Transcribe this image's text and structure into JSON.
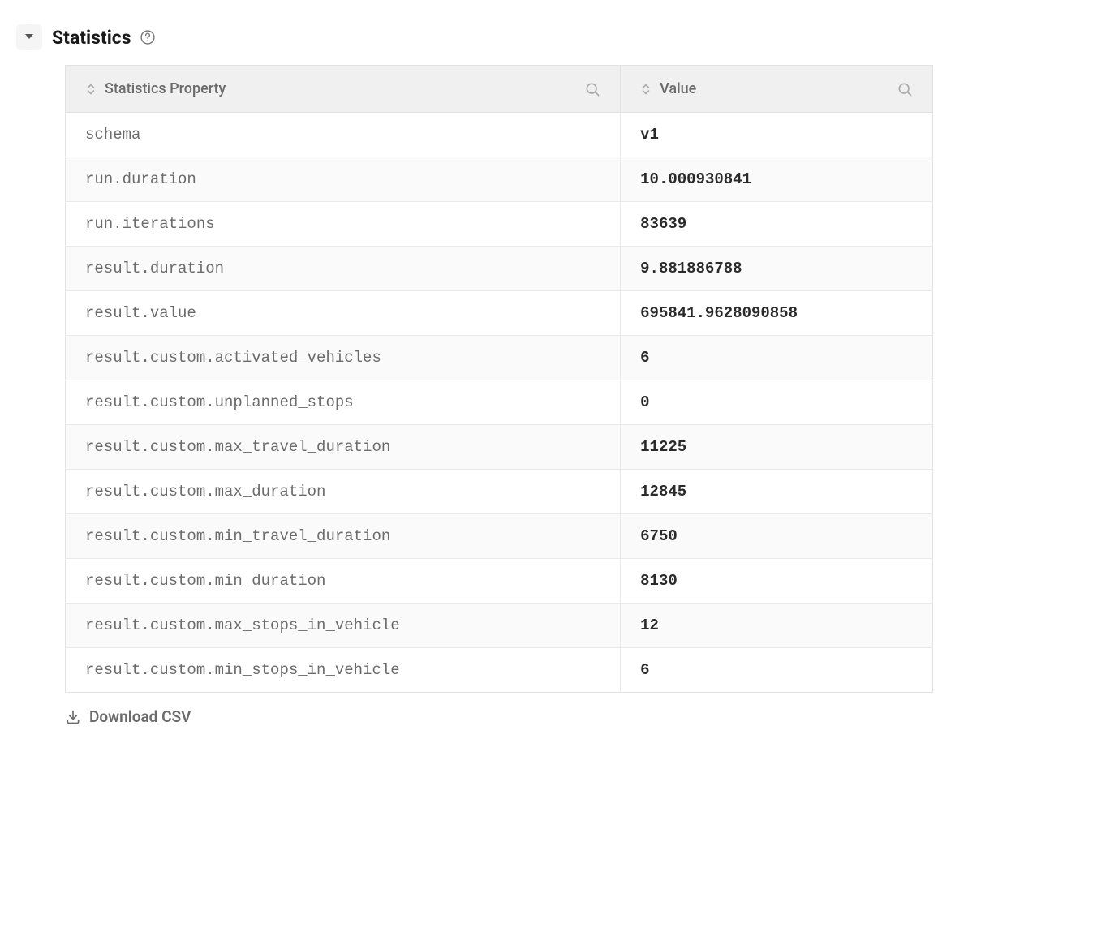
{
  "section": {
    "title": "Statistics",
    "download_label": "Download CSV"
  },
  "table": {
    "columns": {
      "property": "Statistics Property",
      "value": "Value"
    },
    "rows": [
      {
        "property": "schema",
        "value": "v1"
      },
      {
        "property": "run.duration",
        "value": "10.000930841"
      },
      {
        "property": "run.iterations",
        "value": "83639"
      },
      {
        "property": "result.duration",
        "value": "9.881886788"
      },
      {
        "property": "result.value",
        "value": "695841.9628090858"
      },
      {
        "property": "result.custom.activated_vehicles",
        "value": "6"
      },
      {
        "property": "result.custom.unplanned_stops",
        "value": "0"
      },
      {
        "property": "result.custom.max_travel_duration",
        "value": "11225"
      },
      {
        "property": "result.custom.max_duration",
        "value": "12845"
      },
      {
        "property": "result.custom.min_travel_duration",
        "value": "6750"
      },
      {
        "property": "result.custom.min_duration",
        "value": "8130"
      },
      {
        "property": "result.custom.max_stops_in_vehicle",
        "value": "12"
      },
      {
        "property": "result.custom.min_stops_in_vehicle",
        "value": "6"
      }
    ]
  }
}
